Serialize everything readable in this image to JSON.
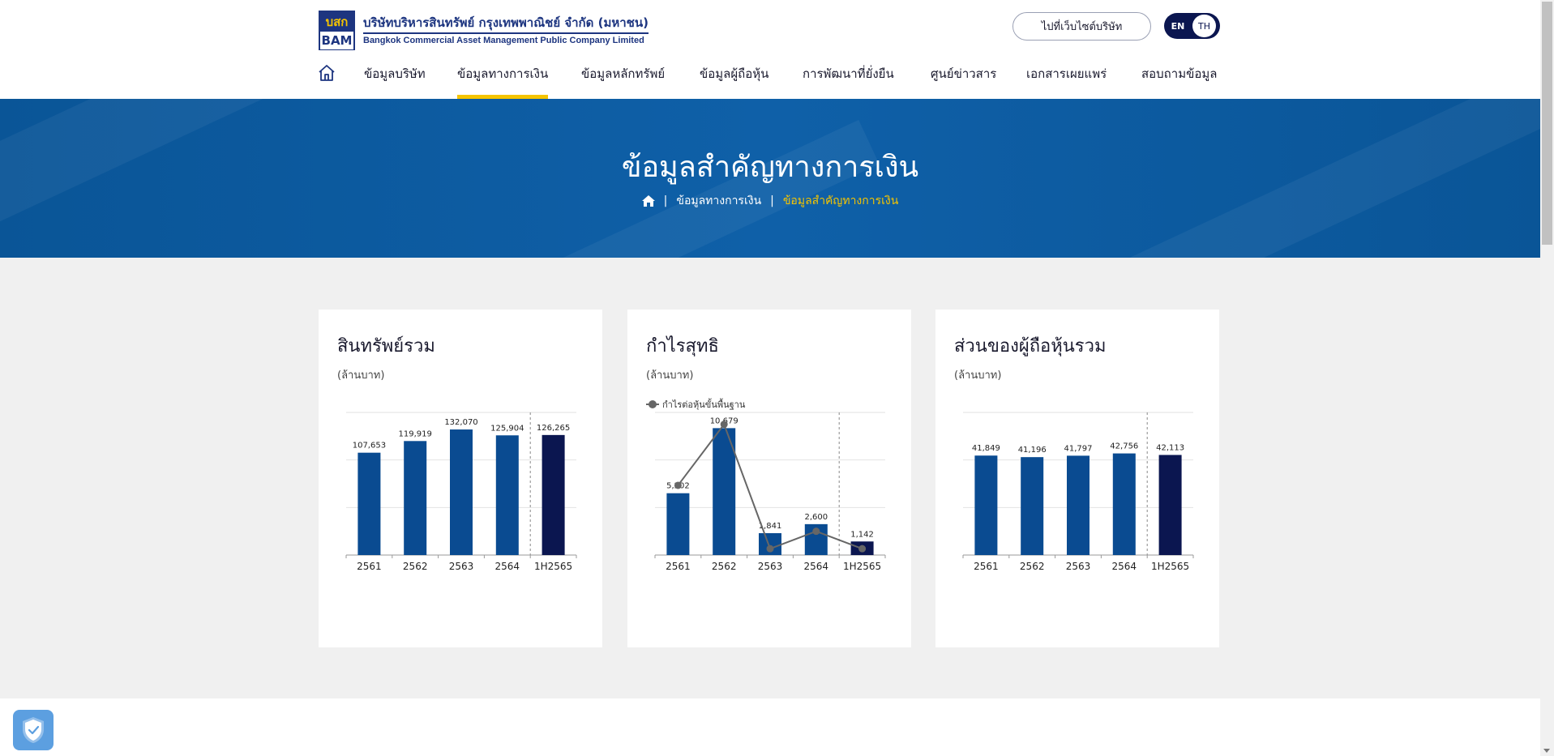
{
  "header": {
    "logo": {
      "top": "บสก",
      "bottom": "BAM",
      "name_th": "บริษัทบริหารสินทรัพย์ กรุงเทพพาณิชย์ จำกัด (มหาชน)",
      "name_en": "Bangkok Commercial Asset Management Public Company Limited"
    },
    "corporate_button": "ไปที่เว็บไซต์บริษัท",
    "lang": {
      "en": "EN",
      "th": "TH",
      "selected": "TH"
    },
    "nav": [
      {
        "label": "ข้อมูลบริษัท"
      },
      {
        "label": "ข้อมูลทางการเงิน",
        "active": true
      },
      {
        "label": "ข้อมูลหลักทรัพย์"
      },
      {
        "label": "ข้อมูลผู้ถือหุ้น"
      },
      {
        "label": "การพัฒนาที่ยั่งยืน"
      },
      {
        "label": "ศูนย์ข่าวสาร"
      },
      {
        "label": "เอกสารเผยแพร่"
      },
      {
        "label": "สอบถามข้อมูล"
      }
    ]
  },
  "banner": {
    "title": "ข้อมูลสำคัญทางการเงิน",
    "breadcrumb": [
      "ข้อมูลทางการเงิน",
      "ข้อมูลสำคัญทางการเงิน"
    ],
    "sep": "|"
  },
  "colors": {
    "bar": "#0a4b91",
    "bar_highlight": "#0b1650",
    "line": "#666666",
    "accent": "#f5c400",
    "banner": "#0a5597"
  },
  "cards": [
    {
      "title": "สินทรัพย์รวม",
      "unit": "(ล้านบาท)"
    },
    {
      "title": "กำไรสุทธิ",
      "unit": "(ล้านบาท)",
      "legend": "กำไรต่อหุ้นขั้นพื้นฐาน"
    },
    {
      "title": "ส่วนของผู้ถือหุ้นรวม",
      "unit": "(ล้านบาท)"
    }
  ],
  "chart_data": [
    {
      "type": "bar",
      "title": "สินทรัพย์รวม",
      "categories": [
        "2561",
        "2562",
        "2563",
        "2564",
        "1H2565"
      ],
      "values": [
        107653,
        119919,
        132070,
        125904,
        126265
      ],
      "labels": [
        "107,653",
        "119,919",
        "132,070",
        "125,904",
        "126,265"
      ],
      "ylim": [
        0,
        150000
      ],
      "grid": true
    },
    {
      "type": "bar",
      "title": "กำไรสุทธิ",
      "categories": [
        "2561",
        "2562",
        "2563",
        "2564",
        "1H2565"
      ],
      "values": [
        5202,
        10679,
        1841,
        2600,
        1142
      ],
      "labels": [
        "5,202",
        "10,679",
        "1,841",
        "2,600",
        "1,142"
      ],
      "ylim": [
        0,
        12000
      ],
      "grid": true,
      "line_series": {
        "name": "กำไรต่อหุ้นขั้นพื้นฐาน",
        "values": [
          1.76,
          3.3,
          0.16,
          0.6,
          0.16
        ],
        "ylim": [
          0,
          3.6
        ]
      }
    },
    {
      "type": "bar",
      "title": "ส่วนของผู้ถือหุ้นรวม",
      "categories": [
        "2561",
        "2562",
        "2563",
        "2564",
        "1H2565"
      ],
      "values": [
        41849,
        41196,
        41797,
        42756,
        42113
      ],
      "labels": [
        "41,849",
        "41,196",
        "41,797",
        "42,756",
        "42,113"
      ],
      "ylim": [
        0,
        60000
      ],
      "grid": true
    }
  ]
}
